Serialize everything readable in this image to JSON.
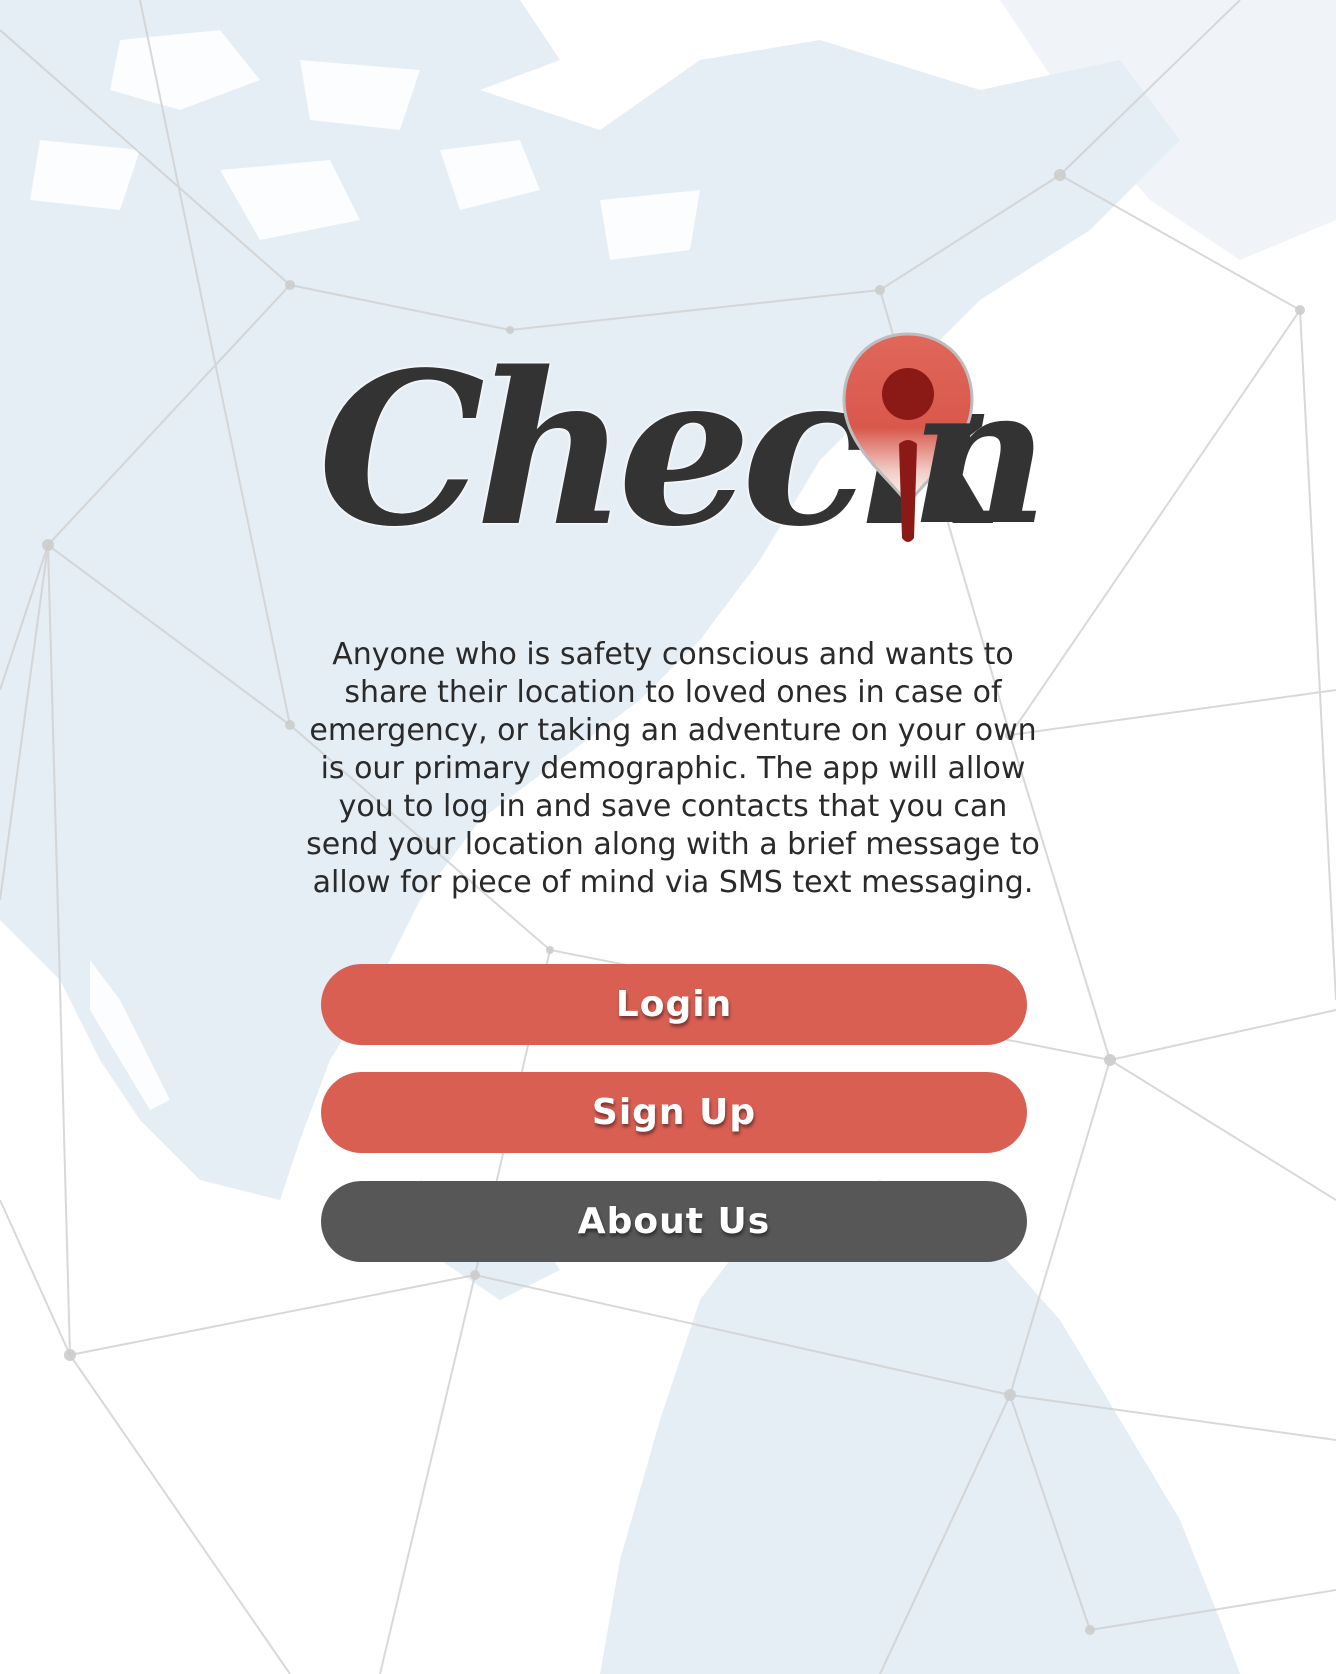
{
  "app": {
    "logo_text": "Check",
    "logo_text_suffix": "n",
    "logo_icon": "map-pin-icon"
  },
  "description": "Anyone who is safety conscious and wants to share their location to loved ones in case of emergency, or taking an adventure on your own is our primary demographic. The app will allow you to log in and save contacts that you can send your location along with a brief message to allow for piece of mind via SMS text messaging.",
  "buttons": {
    "login": "Login",
    "signup": "Sign Up",
    "about": "About Us"
  },
  "colors": {
    "accent": "#d95f53",
    "dark_button": "#575757",
    "text": "#333333",
    "pin_dark": "#8b1a17"
  }
}
